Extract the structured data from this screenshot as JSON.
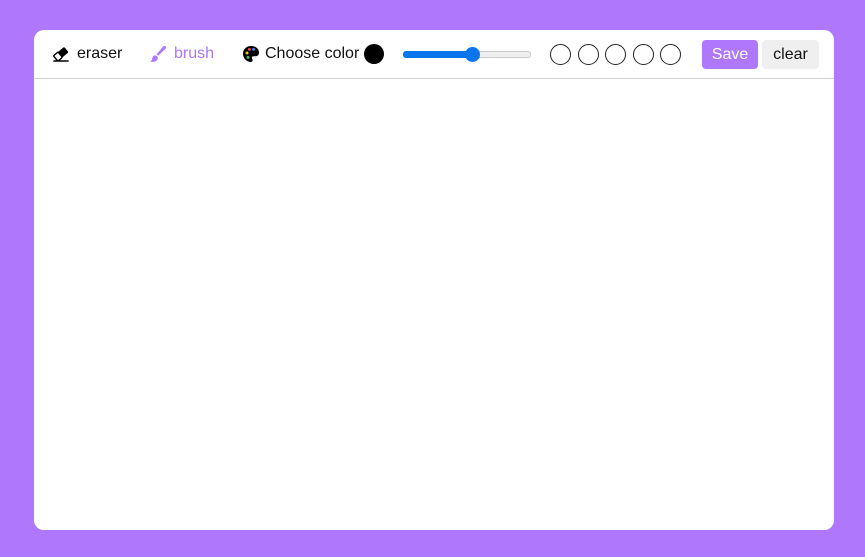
{
  "colors": {
    "background": "#ae77fc",
    "accent": "#ae77fc",
    "slider_fill": "#0b75ec",
    "selected_color": "#000000",
    "clear_button_bg": "#efefef"
  },
  "toolbar": {
    "eraser_label": "eraser",
    "brush_label": "brush",
    "choose_color_label": "Choose color",
    "active_tool": "brush",
    "save_label": "Save",
    "clear_label": "clear"
  },
  "brush_size": {
    "value": 55,
    "min": 0,
    "max": 100
  },
  "icons": {
    "eraser": "eraser-icon",
    "brush": "brush-icon",
    "palette": "palette-icon"
  },
  "color_options": [
    "#ffffff",
    "#ffffff",
    "#ffffff",
    "#ffffff",
    "#ffffff"
  ]
}
